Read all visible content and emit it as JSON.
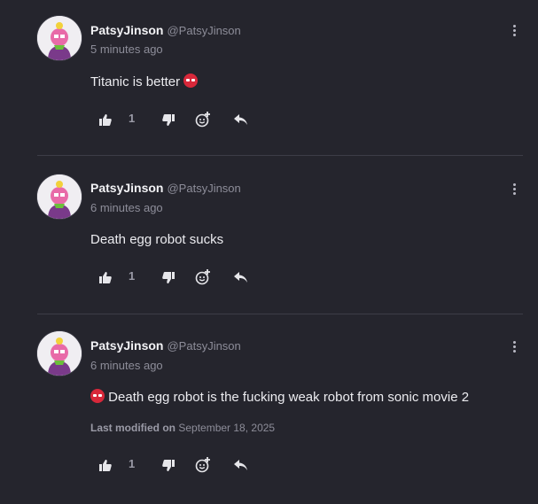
{
  "comments": [
    {
      "author": "PatsyJinson",
      "handle": "@PatsyJinson",
      "time": "5 minutes ago",
      "text": "Titanic is better",
      "likes": "1"
    },
    {
      "author": "PatsyJinson",
      "handle": "@PatsyJinson",
      "time": "6 minutes ago",
      "text": "Death egg robot sucks",
      "likes": "1"
    },
    {
      "author": "PatsyJinson",
      "handle": "@PatsyJinson",
      "time": "6 minutes ago",
      "text": "Death egg robot is the fucking weak robot from sonic movie 2",
      "modified_label": "Last modified on",
      "modified_date": "September 18, 2025",
      "likes": "1"
    }
  ],
  "icons": {
    "like": "thumbs-up-icon",
    "dislike": "thumbs-down-icon",
    "react": "add-reaction-icon",
    "reply": "reply-icon",
    "menu": "more-vertical-icon",
    "emoji": "angry-face-emoji"
  },
  "colors": {
    "background": "#25252d",
    "divider": "#3d3d47",
    "emoji_red": "#d8283a"
  }
}
